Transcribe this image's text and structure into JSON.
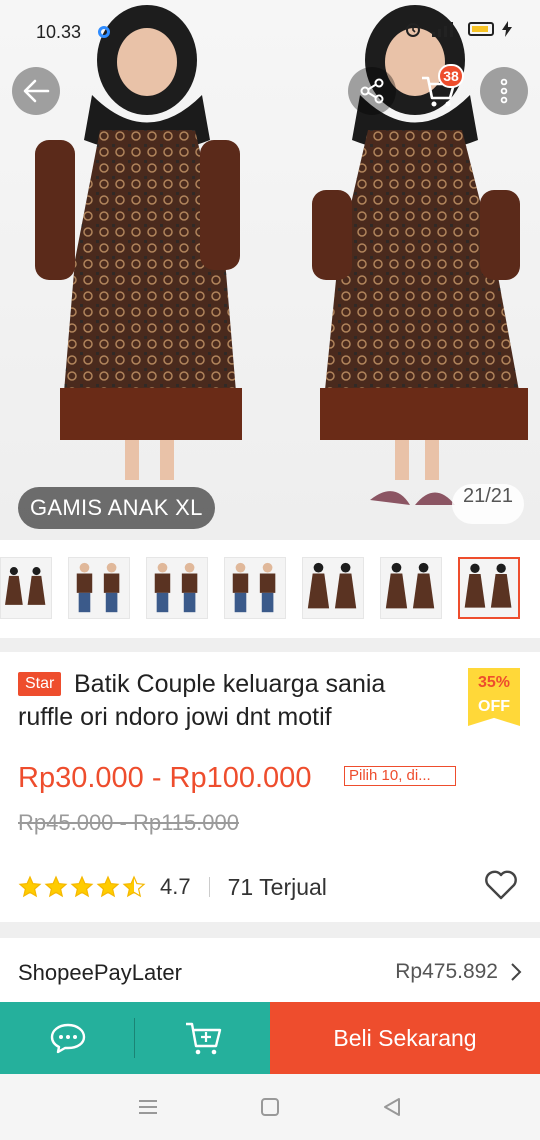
{
  "status_bar": {
    "time": "10.33"
  },
  "colors": {
    "brand": "#ee4d2d",
    "action_green": "#25b09c",
    "badge_yellow": "#ffd839"
  },
  "gallery": {
    "caption": "GAMIS ANAK XL",
    "counter": "21/21",
    "cart_count": "38",
    "thumbnail_count": 7,
    "selected_thumbnail": 7
  },
  "product": {
    "badge": "Star",
    "title": "Batik Couple keluarga sania ruffle ori ndoro jowi dnt motif",
    "discount_pct": "35%",
    "discount_off": "OFF",
    "price_range": "Rp30.000 - Rp100.000",
    "promo": "Pilih 10, di...",
    "original_price": "Rp45.000 - Rp115.000",
    "rating": "4.7",
    "rating_stars": 4.5,
    "sold": "71 Terjual"
  },
  "paylater": {
    "label": "ShopeePayLater",
    "amount": "Rp475.892"
  },
  "actions": {
    "buy_label": "Beli Sekarang"
  },
  "icons": [
    "back-arrow-icon",
    "share-icon",
    "cart-icon",
    "more-vert-icon",
    "chat-icon",
    "add-cart-icon",
    "heart-icon",
    "chevron-right-icon",
    "menu-icon",
    "home-square-icon",
    "back-triangle-icon",
    "star-icon"
  ]
}
